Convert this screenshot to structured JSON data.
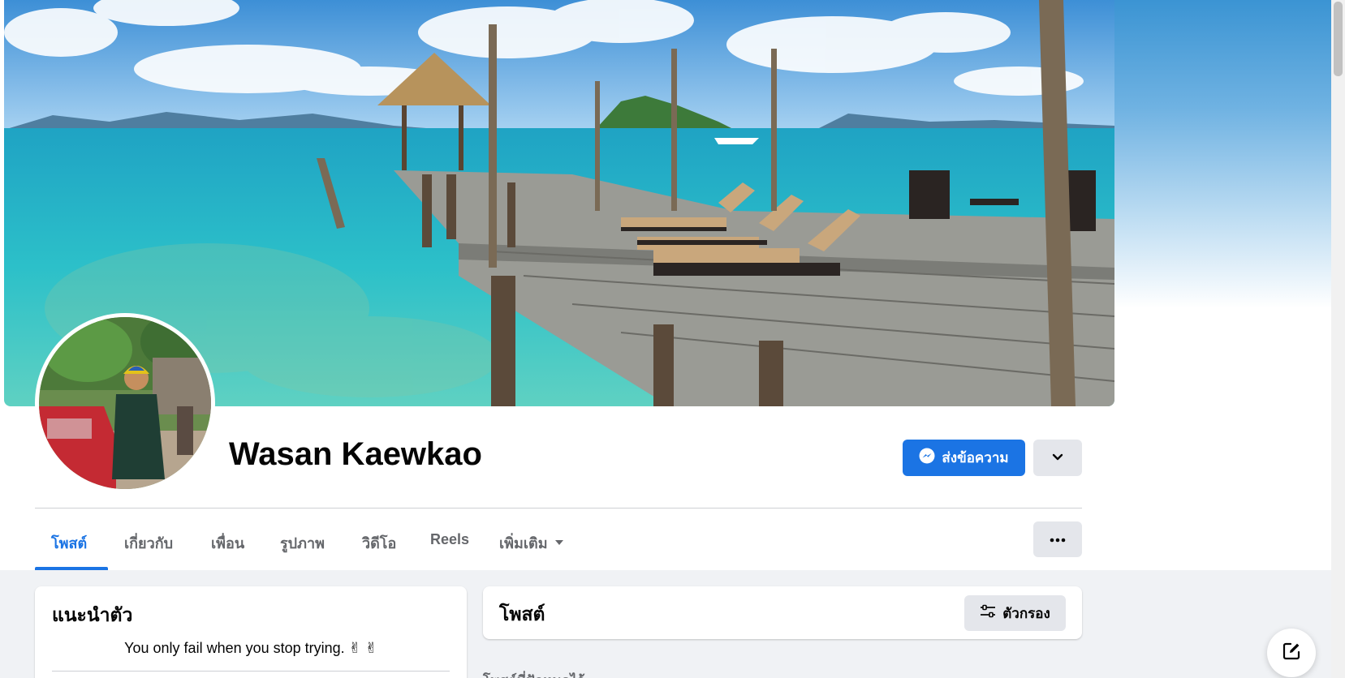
{
  "profile": {
    "name": "Wasan Kaewkao",
    "message_button_label": "ส่งข้อความ"
  },
  "tabs": [
    {
      "label": "โพสต์",
      "active": true
    },
    {
      "label": "เกี่ยวกับ",
      "active": false
    },
    {
      "label": "เพื่อน",
      "active": false
    },
    {
      "label": "รูปภาพ",
      "active": false
    },
    {
      "label": "วิดีโอ",
      "active": false
    },
    {
      "label": "Reels",
      "active": false
    },
    {
      "label": "เพิ่มเติม",
      "active": false
    }
  ],
  "intro": {
    "title": "แนะนำตัว",
    "bio": "You only fail when you stop trying. ✌ ✌"
  },
  "posts": {
    "title": "โพสต์",
    "filter_label": "ตัวกรอง",
    "partial_text": "โพสต์ที่ปักหมุดไว้"
  },
  "icons": {
    "message": "messenger-icon",
    "dropdown": "chevron-down-icon",
    "more_tab": "caret-down-icon",
    "more_actions": "more-dots-icon",
    "filter": "sliders-icon",
    "compose": "compose-icon"
  },
  "colors": {
    "accent": "#1b74e4",
    "secondary_button": "#e4e6eb",
    "background": "#f0f2f5"
  }
}
